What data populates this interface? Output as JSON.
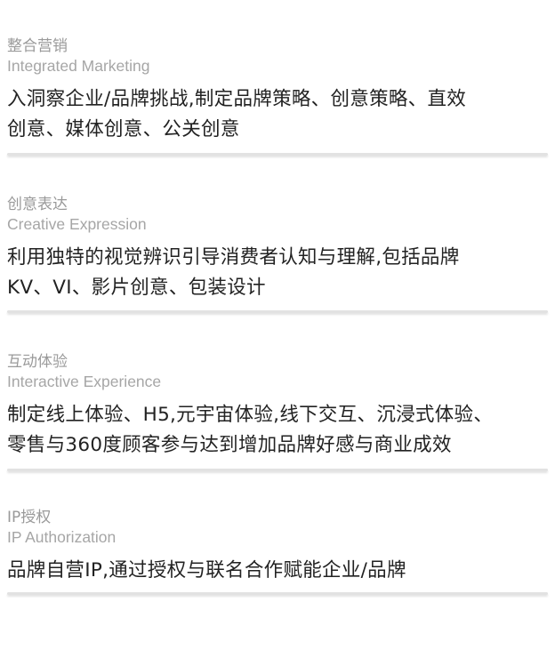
{
  "sections": [
    {
      "title_cn": "整合营销",
      "title_en": "Integrated Marketing",
      "desc_lines": [
        "入洞察企业/品牌挑战,制定品牌策略、创意策略、直效",
        "创意、媒体创意、公关创意"
      ]
    },
    {
      "title_cn": "创意表达",
      "title_en": "Creative Expression",
      "desc_lines": [
        "利用独特的视觉辨识引导消费者认知与理解,包括品牌",
        "KV、VI、影片创意、包装设计"
      ]
    },
    {
      "title_cn": "互动体验",
      "title_en": "Interactive Experience",
      "desc_lines": [
        "制定线上体验、H5,元宇宙体验,线下交互、沉浸式体验、",
        "零售与360度顾客参与达到增加品牌好感与商业成效"
      ]
    },
    {
      "title_cn": "IP授权",
      "title_en": "IP Authorization",
      "desc_lines": [
        "品牌自营IP,通过授权与联名合作赋能企业/品牌"
      ]
    }
  ]
}
